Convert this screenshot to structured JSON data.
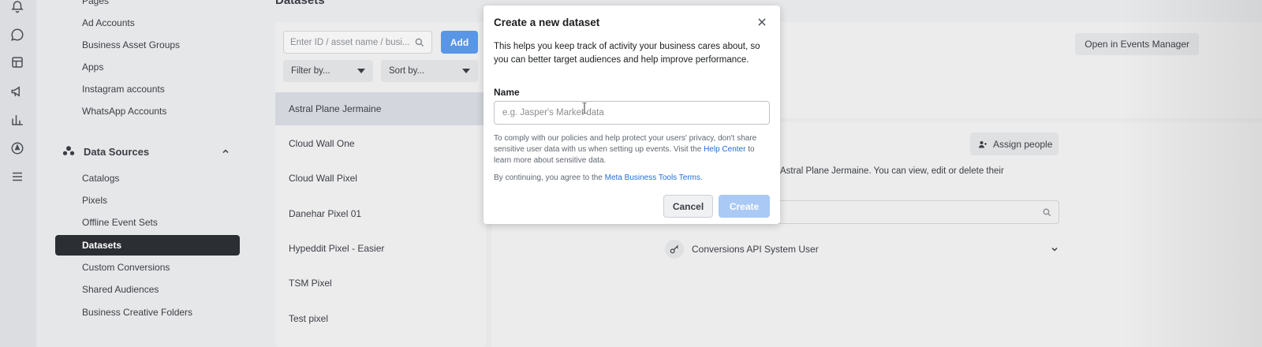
{
  "sidebar": {
    "items_top": [
      {
        "label": "Pages"
      },
      {
        "label": "Ad Accounts"
      },
      {
        "label": "Business Asset Groups"
      },
      {
        "label": "Apps"
      },
      {
        "label": "Instagram accounts"
      },
      {
        "label": "WhatsApp Accounts"
      }
    ],
    "section": {
      "label": "Data Sources",
      "icon": "people-group-icon"
    },
    "items_data_sources": [
      {
        "label": "Catalogs"
      },
      {
        "label": "Pixels"
      },
      {
        "label": "Offline Event Sets"
      },
      {
        "label": "Datasets",
        "active": true
      },
      {
        "label": "Custom Conversions"
      },
      {
        "label": "Shared Audiences"
      },
      {
        "label": "Business Creative Folders"
      }
    ]
  },
  "rail": {
    "icons": [
      "bell-icon",
      "chat-icon",
      "pages-icon",
      "megaphone-icon",
      "chart-icon",
      "compass-icon",
      "menu-icon"
    ]
  },
  "page": {
    "title": "Datasets"
  },
  "list": {
    "search_placeholder": "Enter ID / asset name / busi...",
    "add_label": "Add",
    "filter_label": "Filter by...",
    "sort_label": "Sort by...",
    "datasets": [
      {
        "name": "Astral Plane Jermaine",
        "selected": true
      },
      {
        "name": "Cloud Wall One"
      },
      {
        "name": "Cloud Wall Pixel"
      },
      {
        "name": "Danehar Pixel 01"
      },
      {
        "name": "Hypeddit Pixel - Easier"
      },
      {
        "name": "TSM Pixel"
      },
      {
        "name": "Test pixel"
      }
    ]
  },
  "details": {
    "open_events_label": "Open in Events Manager",
    "assign_label": "Assign people",
    "desc_visible": "o Astral Plane Jermaine. You can view, edit or delete their",
    "system_user": "Conversions API System User"
  },
  "modal": {
    "title": "Create a new dataset",
    "intro": "This helps you keep track of activity your business cares about, so you can better target audiences and help improve performance.",
    "name_label": "Name",
    "name_placeholder": "e.g. Jasper's Market data",
    "name_value": "",
    "policy_before": "To comply with our policies and help protect your users' privacy, don't share sensitive user data with us when setting up events. Visit the ",
    "policy_link": "Help Center",
    "policy_after": " to learn more about sensitive data.",
    "agree_before": "By continuing, you agree to the ",
    "agree_link": "Meta Business Tools Terms.",
    "cancel_label": "Cancel",
    "create_label": "Create"
  },
  "colors": {
    "accent": "#1b74e4",
    "active_nav": "#2b2e33",
    "link": "#216fdb"
  }
}
